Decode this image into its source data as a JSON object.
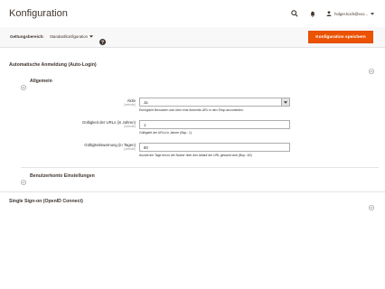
{
  "header": {
    "title": "Konfiguration",
    "user_name": "holger.koch@eco..."
  },
  "icons": {
    "search": "search-icon",
    "notifications": "bell-icon",
    "user": "user-icon",
    "help": "help-icon"
  },
  "scope": {
    "label": "Geltungsbereich:",
    "value": "Standardkonfiguration"
  },
  "toolbar": {
    "save_label": "Konfiguration speichern"
  },
  "sections": {
    "auto_login": {
      "title": "Automatische Anmeldung (Auto-Login)"
    },
    "general": {
      "title": "Allgemein"
    },
    "account_settings": {
      "title": "Benutzerkonto Einstellungen"
    },
    "sso": {
      "title": "Single Sign-on (OpenID Connect)"
    }
  },
  "fields": {
    "active": {
      "label": "Aktiv",
      "scope": "[website]",
      "value": "Ja",
      "note": "Ermöglicht Benutzern sich über eine Anmelde-URL in den Shop anzumelden."
    },
    "url_validity": {
      "label": "Gültigkeit der URLs (in Jahren)",
      "scope": "[website]",
      "value": "1",
      "note": "Gültigkeit der URLs in Jahren (Bsp.: 1)"
    },
    "validity_warning": {
      "label": "Gültigkeitswarnung (in Tagen)",
      "scope": "[website]",
      "value": "60",
      "note": "Anzahl der Tage bevor der Nutzer über den Ablauf der URL gewarnt wird (Bsp.: 60)"
    }
  },
  "colors": {
    "accent": "#eb5202",
    "text": "#303030",
    "heading": "#41362f"
  }
}
